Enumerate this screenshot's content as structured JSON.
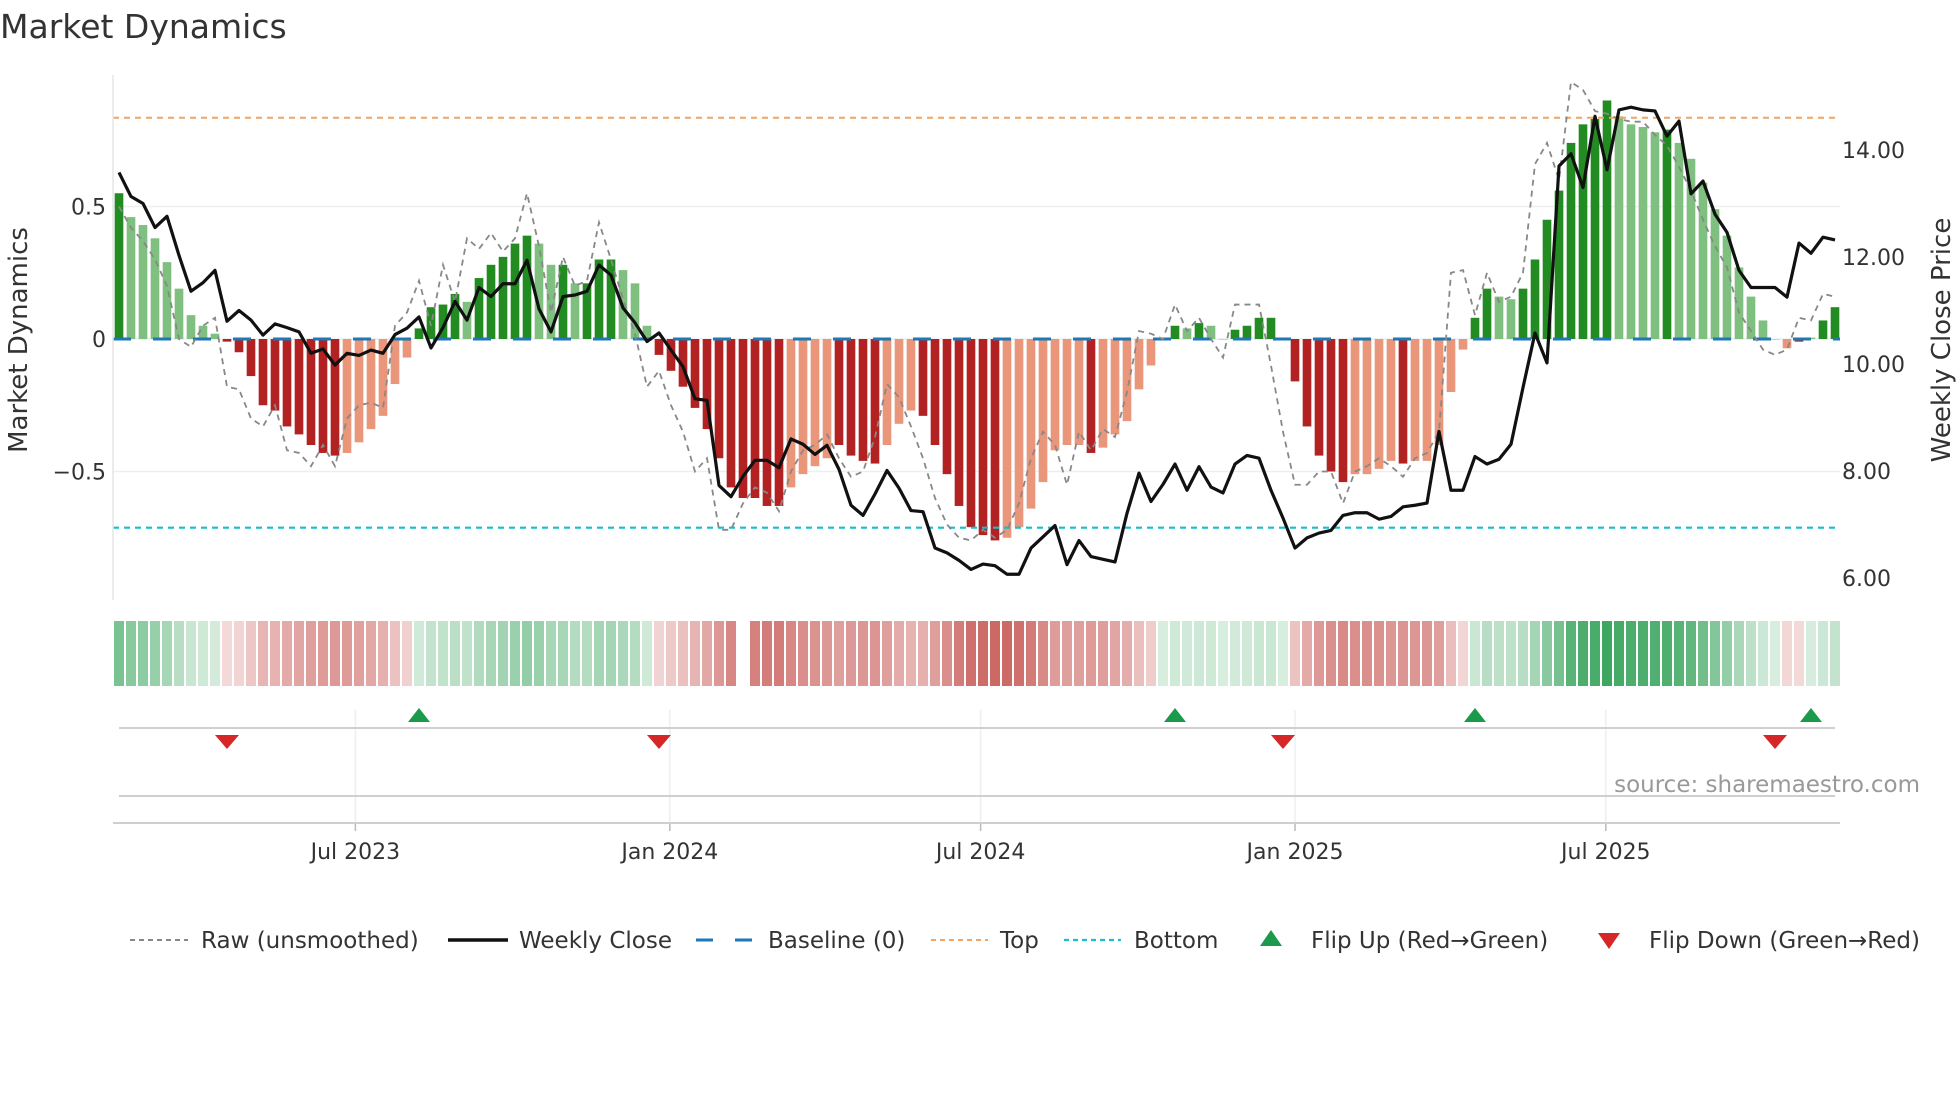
{
  "chart_data": {
    "type": "bar",
    "title": "Market Dynamics",
    "ylabel": "Market Dynamics",
    "y2label": "Weekly Close Price",
    "ylim": [
      -0.98,
      0.98
    ],
    "y2lim": [
      5.3,
      15.1
    ],
    "yticks": [
      {
        "v": 0.5,
        "label": "0.5"
      },
      {
        "v": 0,
        "label": "0"
      },
      {
        "v": -0.5,
        "label": "−0.5"
      }
    ],
    "y2ticks": [
      {
        "v": 14,
        "label": "14.00"
      },
      {
        "v": 12,
        "label": "12.00"
      },
      {
        "v": 10,
        "label": "10.00"
      },
      {
        "v": 8,
        "label": "8.00"
      },
      {
        "v": 6,
        "label": "6.00"
      }
    ],
    "xticks": [
      {
        "week": 19.7,
        "label": "Jul 2023"
      },
      {
        "week": 45.9,
        "label": "Jan 2024"
      },
      {
        "week": 71.8,
        "label": "Jul 2024"
      },
      {
        "week": 98.0,
        "label": "Jan 2025"
      },
      {
        "week": 123.9,
        "label": "Jul 2025"
      }
    ],
    "top": 0.835,
    "bottom": -0.712,
    "baseline": 0,
    "smoothed": [
      0.55,
      0.46,
      0.43,
      0.38,
      0.29,
      0.19,
      0.09,
      0.05,
      0.02,
      -0.01,
      -0.05,
      -0.14,
      -0.25,
      -0.27,
      -0.33,
      -0.36,
      -0.4,
      -0.43,
      -0.44,
      -0.43,
      -0.39,
      -0.34,
      -0.29,
      -0.17,
      -0.07,
      0.04,
      0.12,
      0.13,
      0.17,
      0.14,
      0.23,
      0.28,
      0.31,
      0.36,
      0.39,
      0.36,
      0.28,
      0.28,
      0.21,
      0.21,
      0.3,
      0.3,
      0.26,
      0.21,
      0.05,
      -0.06,
      -0.12,
      -0.18,
      -0.26,
      -0.34,
      -0.45,
      -0.56,
      -0.6,
      -0.6,
      -0.63,
      -0.63,
      -0.56,
      -0.51,
      -0.48,
      -0.45,
      -0.4,
      -0.44,
      -0.46,
      -0.47,
      -0.4,
      -0.32,
      -0.27,
      -0.29,
      -0.4,
      -0.51,
      -0.63,
      -0.71,
      -0.74,
      -0.76,
      -0.75,
      -0.71,
      -0.64,
      -0.54,
      -0.42,
      -0.4,
      -0.4,
      -0.43,
      -0.41,
      -0.36,
      -0.31,
      -0.19,
      -0.1,
      0.0,
      0.05,
      0.04,
      0.06,
      0.05,
      0.0,
      0.035,
      0.05,
      0.08,
      0.08,
      0.0,
      -0.16,
      -0.33,
      -0.44,
      -0.5,
      -0.54,
      -0.51,
      -0.51,
      -0.49,
      -0.46,
      -0.47,
      -0.46,
      -0.46,
      -0.4,
      -0.2,
      -0.04,
      0.08,
      0.19,
      0.16,
      0.15,
      0.19,
      0.3,
      0.45,
      0.56,
      0.74,
      0.81,
      0.83,
      0.9,
      0.84,
      0.81,
      0.8,
      0.78,
      0.79,
      0.74,
      0.68,
      0.59,
      0.49,
      0.39,
      0.27,
      0.16,
      0.07,
      0.0,
      -0.035,
      -0.01,
      0.005,
      0.07,
      0.12
    ],
    "strong": [
      1,
      0,
      0,
      0,
      0,
      0,
      0,
      0,
      0,
      1,
      1,
      1,
      1,
      1,
      1,
      1,
      1,
      1,
      1,
      0,
      0,
      0,
      0,
      0,
      0,
      1,
      1,
      1,
      1,
      0,
      1,
      1,
      1,
      1,
      1,
      0,
      0,
      1,
      0,
      1,
      1,
      1,
      0,
      0,
      0,
      1,
      1,
      1,
      1,
      1,
      1,
      1,
      1,
      1,
      1,
      1,
      0,
      0,
      0,
      0,
      1,
      1,
      1,
      1,
      0,
      0,
      0,
      1,
      1,
      1,
      1,
      1,
      1,
      1,
      0,
      0,
      0,
      0,
      0,
      0,
      0,
      1,
      0,
      0,
      0,
      0,
      0,
      0,
      1,
      0,
      1,
      0,
      0,
      1,
      1,
      1,
      1,
      0,
      1,
      1,
      1,
      1,
      1,
      0,
      0,
      0,
      0,
      1,
      0,
      0,
      0,
      0,
      0,
      1,
      1,
      0,
      0,
      1,
      1,
      1,
      1,
      1,
      1,
      1,
      1,
      0,
      0,
      0,
      0,
      1,
      0,
      0,
      0,
      0,
      0,
      0,
      0,
      0,
      0,
      0,
      1,
      0,
      1,
      1,
      1
    ],
    "raw": [
      0.5,
      0.42,
      0.37,
      0.3,
      0.2,
      0.0,
      -0.03,
      0.05,
      0.08,
      -0.18,
      -0.19,
      -0.3,
      -0.33,
      -0.25,
      -0.42,
      -0.43,
      -0.48,
      -0.4,
      -0.48,
      -0.3,
      -0.25,
      -0.24,
      -0.26,
      0.05,
      0.1,
      0.22,
      0.05,
      0.28,
      0.14,
      0.38,
      0.34,
      0.4,
      0.33,
      0.38,
      0.55,
      0.35,
      0.1,
      0.31,
      0.2,
      0.22,
      0.44,
      0.3,
      0.15,
      0.02,
      -0.18,
      -0.12,
      -0.25,
      -0.35,
      -0.5,
      -0.45,
      -0.72,
      -0.72,
      -0.62,
      -0.56,
      -0.58,
      -0.65,
      -0.5,
      -0.42,
      -0.4,
      -0.36,
      -0.45,
      -0.52,
      -0.5,
      -0.37,
      -0.17,
      -0.22,
      -0.33,
      -0.45,
      -0.6,
      -0.7,
      -0.75,
      -0.76,
      -0.72,
      -0.75,
      -0.72,
      -0.62,
      -0.45,
      -0.35,
      -0.4,
      -0.55,
      -0.35,
      -0.42,
      -0.34,
      -0.37,
      -0.2,
      0.03,
      0.02,
      0.0,
      0.13,
      0.03,
      0.08,
      0.0,
      -0.07,
      0.13,
      0.13,
      0.13,
      -0.1,
      -0.35,
      -0.55,
      -0.55,
      -0.5,
      -0.5,
      -0.62,
      -0.5,
      -0.48,
      -0.45,
      -0.48,
      -0.52,
      -0.45,
      -0.43,
      -0.35,
      0.25,
      0.26,
      0.09,
      0.25,
      0.14,
      0.16,
      0.25,
      0.66,
      0.74,
      0.6,
      0.97,
      0.94,
      0.86,
      0.85,
      0.83,
      0.82,
      0.82,
      0.77,
      0.73,
      0.65,
      0.56,
      0.45,
      0.35,
      0.27,
      0.1,
      0.03,
      -0.04,
      -0.06,
      -0.04,
      0.08,
      0.07,
      0.17,
      0.16
    ],
    "close": [
      13.58,
      13.13,
      13.0,
      12.55,
      12.76,
      12.03,
      11.36,
      11.52,
      11.75,
      10.8,
      11.0,
      10.82,
      10.54,
      10.75,
      10.68,
      10.6,
      10.2,
      10.28,
      9.98,
      10.2,
      10.16,
      10.26,
      10.2,
      10.55,
      10.67,
      10.88,
      10.3,
      10.68,
      11.17,
      10.82,
      11.43,
      11.26,
      11.5,
      11.5,
      11.94,
      11.03,
      10.6,
      11.26,
      11.29,
      11.36,
      11.85,
      11.66,
      11.05,
      10.77,
      10.42,
      10.58,
      10.26,
      9.95,
      9.35,
      9.32,
      7.73,
      7.52,
      7.9,
      8.2,
      8.2,
      8.06,
      8.6,
      8.5,
      8.31,
      8.48,
      8.03,
      7.36,
      7.17,
      7.57,
      8.01,
      7.68,
      7.26,
      7.24,
      6.56,
      6.47,
      6.33,
      6.16,
      6.26,
      6.23,
      6.07,
      6.07,
      6.56,
      6.77,
      6.98,
      6.25,
      6.7,
      6.4,
      6.35,
      6.3,
      7.21,
      7.96,
      7.43,
      7.75,
      8.13,
      7.64,
      8.08,
      7.7,
      7.59,
      8.13,
      8.29,
      8.24,
      7.64,
      7.12,
      6.56,
      6.75,
      6.84,
      6.89,
      7.17,
      7.22,
      7.22,
      7.1,
      7.15,
      7.33,
      7.36,
      7.4,
      8.74,
      7.64,
      7.64,
      8.27,
      8.13,
      8.22,
      8.5,
      9.56,
      10.58,
      10.02,
      13.7,
      13.93,
      13.3,
      14.63,
      13.63,
      14.75,
      14.8,
      14.75,
      14.73,
      14.26,
      14.54,
      13.18,
      13.42,
      12.8,
      12.46,
      11.75,
      11.43,
      11.43,
      11.43,
      11.25,
      12.26,
      12.07,
      12.37,
      12.32
    ],
    "band_missing_week": 52,
    "flip_up_weeks": [
      25,
      88,
      113,
      141
    ],
    "flip_down_weeks": [
      9,
      45,
      97,
      138
    ],
    "legend_position": "bottom",
    "legend": [
      {
        "key": "raw",
        "label": "Raw (unsmoothed)"
      },
      {
        "key": "close",
        "label": "Weekly Close"
      },
      {
        "key": "baseline",
        "label": "Baseline (0)"
      },
      {
        "key": "top",
        "label": "Top"
      },
      {
        "key": "bottom",
        "label": "Bottom"
      },
      {
        "key": "flip_up",
        "label": "Flip Up (Red→Green)"
      },
      {
        "key": "flip_down",
        "label": "Flip Down (Green→Red)"
      }
    ],
    "source": "source: sharemaestro.com",
    "colors": {
      "pos_strong": "#228b22",
      "pos_weak": "#7fbf7f",
      "neg_strong": "#b22222",
      "neg_weak": "#e9967a",
      "raw": "#888888",
      "close": "#111111",
      "baseline": "#1f77b4",
      "top": "#f4a460",
      "bottom": "#17becf",
      "flip_up": "#1a9a4a",
      "flip_down": "#d62728"
    }
  }
}
